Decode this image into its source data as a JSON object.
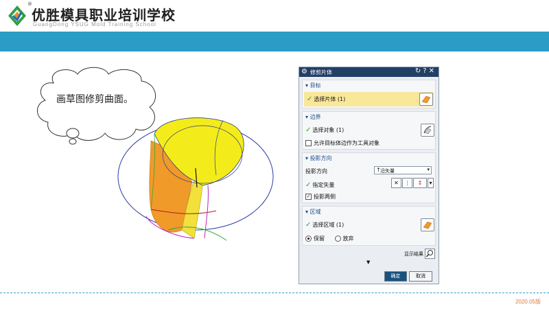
{
  "brand": {
    "name_cn": "优胜模具职业培训学校",
    "name_en": "GuangDong YSUG Mold Training School",
    "registered_mark": "®",
    "accent_color": "#2a9cc6"
  },
  "callout": {
    "text": "画草图修剪曲面。"
  },
  "dialog": {
    "title": "修剪片体",
    "title_icons": [
      "gear-icon",
      "reset-icon",
      "help-icon",
      "close-icon"
    ],
    "header_color": "#233f66",
    "sections": {
      "target": {
        "label": "目标",
        "select_label": "选择片体 (1)"
      },
      "boundary": {
        "label": "边界",
        "select_label": "选择对象 (1)",
        "checkbox_label": "允许目标体边作为工具对象",
        "checkbox_checked": false
      },
      "projection": {
        "label": "投影方向",
        "direction_label": "投影方向",
        "direction_value": "沿矢量",
        "vector_label": "指定矢量",
        "both_sides_label": "投影两侧",
        "both_sides_checked": true
      },
      "region": {
        "label": "区域",
        "select_label": "选择区域 (1)",
        "keep_label": "保留",
        "discard_label": "放弃",
        "keep_selected": true
      }
    },
    "show_result_label": "显示结果",
    "ok_label": "确定",
    "cancel_label": "取消"
  },
  "footer": {
    "version": "2020.05版"
  }
}
